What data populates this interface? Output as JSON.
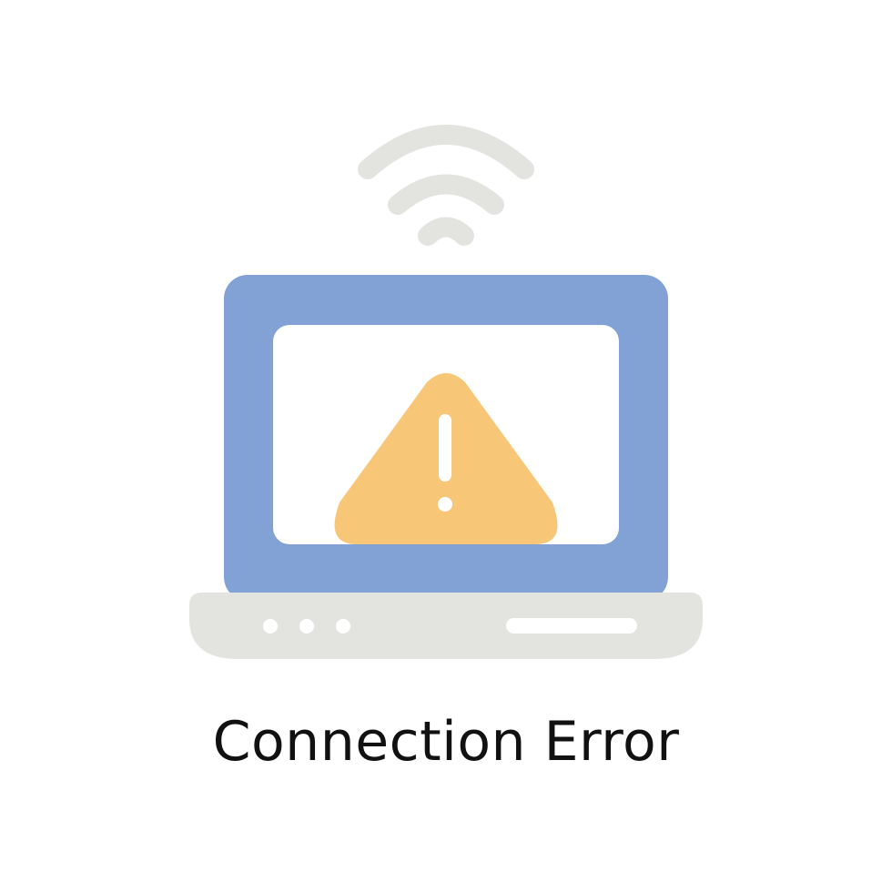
{
  "caption": {
    "text": "Connection Error"
  },
  "colors": {
    "background": "#ffffff",
    "laptop_body": "#82a1d4",
    "laptop_screen": "#ffffff",
    "laptop_base": "#e3e3e0",
    "wifi_signal": "#e3e3e0",
    "warning_triangle": "#f8c677",
    "warning_mark": "#ffffff",
    "caption_text": "#111111"
  },
  "icons": {
    "main": "laptop-icon",
    "signal": "wifi-icon",
    "alert": "warning-triangle-icon"
  }
}
